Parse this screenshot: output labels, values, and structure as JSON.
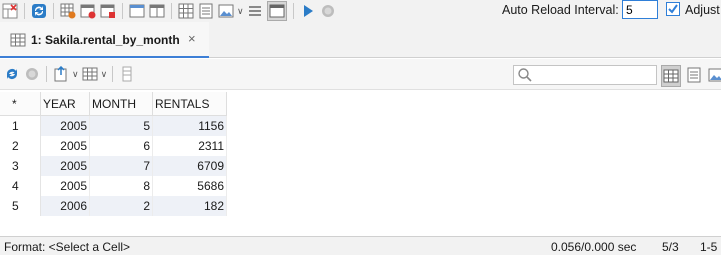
{
  "toolbar": {
    "auto_reload_label": "Auto Reload Interval:",
    "auto_reload_value": "5",
    "adjust_label": "Adjust",
    "icons": [
      "table-x-icon",
      "refresh-icon",
      "grid-settings-icon",
      "red-grid-icon",
      "red-window-icon",
      "window-icon",
      "window-split-icon",
      "grid-icon",
      "list-icon",
      "image-icon",
      "chevron-down-icon",
      "list-view-icon",
      "panel-toggle-icon",
      "run-icon",
      "stop-icon"
    ]
  },
  "tab": {
    "label": "1: Sakila.rental_by_month",
    "close": "×"
  },
  "search": {
    "placeholder": ""
  },
  "grid": {
    "corner": "*",
    "columns": [
      "YEAR",
      "MONTH",
      "RENTALS"
    ],
    "rows": [
      {
        "n": "1",
        "year": "2005",
        "month": "5",
        "rentals": "1156"
      },
      {
        "n": "2",
        "year": "2005",
        "month": "6",
        "rentals": "2311"
      },
      {
        "n": "3",
        "year": "2005",
        "month": "7",
        "rentals": "6709"
      },
      {
        "n": "4",
        "year": "2005",
        "month": "8",
        "rentals": "5686"
      },
      {
        "n": "5",
        "year": "2006",
        "month": "2",
        "rentals": "182"
      }
    ]
  },
  "status": {
    "format": "Format: <Select a Cell>",
    "time": "0.056/0.000 sec",
    "position": "5/3",
    "range": "1-5"
  }
}
